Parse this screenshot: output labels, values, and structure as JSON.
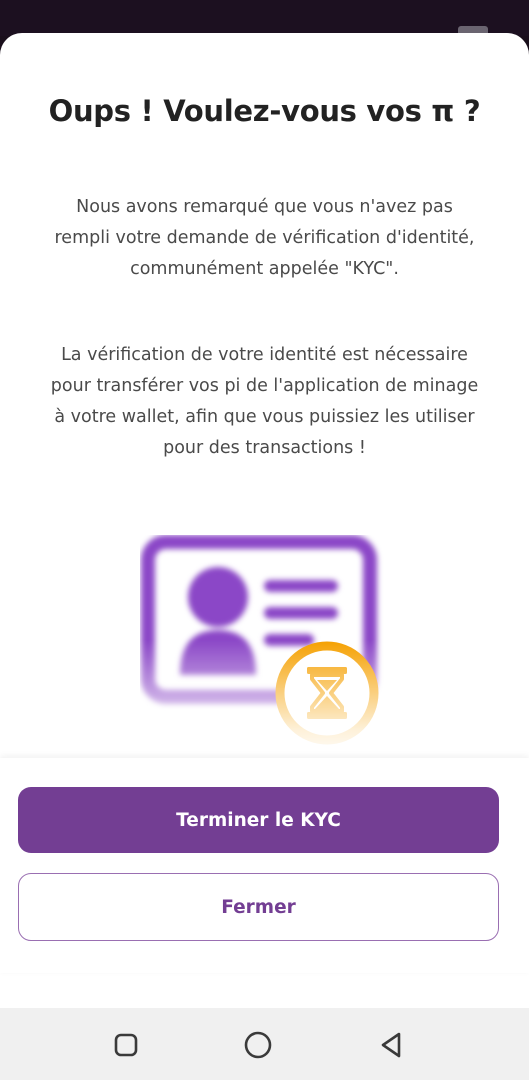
{
  "dialog": {
    "title": "Oups ! Voulez-vous vos π ?",
    "paragraph_1": "Nous avons remarqué que vous n'avez pas rempli votre demande de vérification d'identité, communément appelée \"KYC\".",
    "paragraph_2": "La vérification de votre identité est nécessaire pour transférer vos pi de l'application de minage à votre wallet, afin que vous puissiez les utiliser pour des transactions !",
    "illustration_icon": "id-card-icon",
    "status_icon": "hourglass-icon"
  },
  "actions": {
    "primary_label": "Terminer le KYC",
    "secondary_label": "Fermer"
  },
  "navigation": {
    "icons": [
      "recent-apps-icon",
      "home-icon",
      "back-icon"
    ]
  },
  "colors": {
    "accent": "#733E93",
    "illustration": "#8B47C7",
    "pending": "#F5A000",
    "title": "#222222",
    "body_text": "#4A4A4A"
  }
}
